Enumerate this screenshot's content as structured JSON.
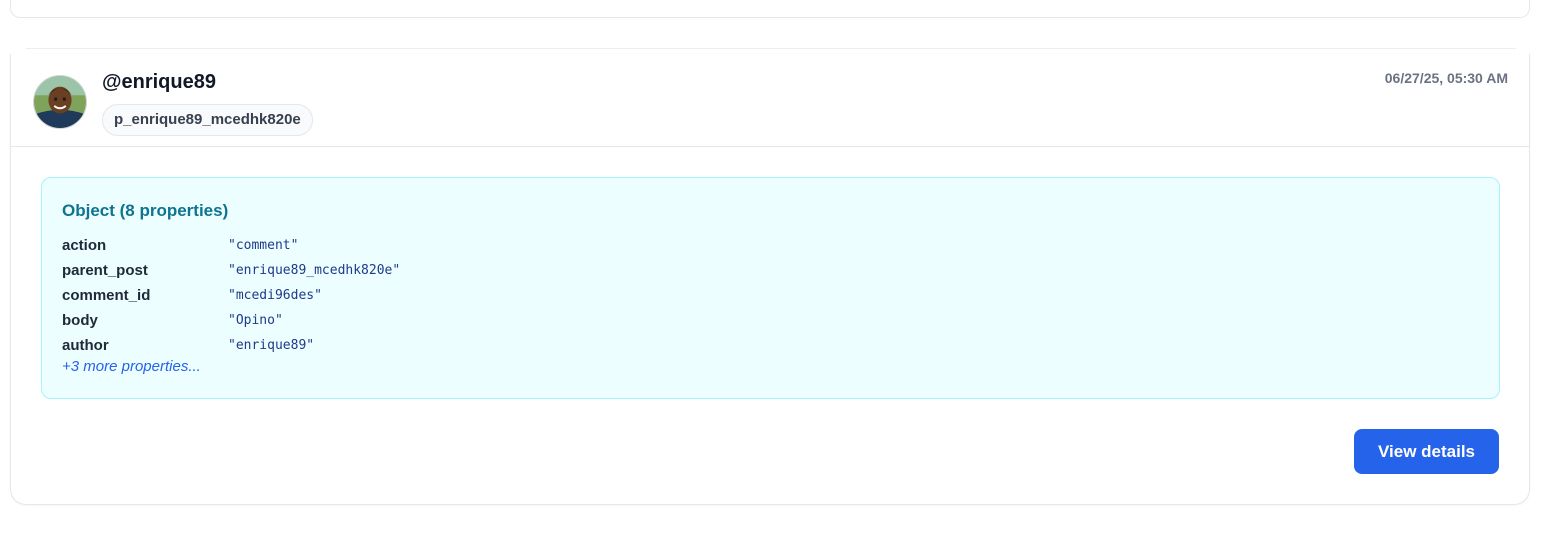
{
  "post": {
    "username": "@enrique89",
    "post_id": "p_enrique89_mcedhk820e",
    "timestamp": "06/27/25, 05:30 AM",
    "avatar_icon": "user-avatar-photo"
  },
  "object": {
    "title": "Object (8 properties)",
    "properties": [
      {
        "key": "action",
        "value": "\"comment\""
      },
      {
        "key": "parent_post",
        "value": "\"enrique89_mcedhk820e\""
      },
      {
        "key": "comment_id",
        "value": "\"mcedi96des\""
      },
      {
        "key": "body",
        "value": "\"Opino\""
      },
      {
        "key": "author",
        "value": "\"enrique89\""
      }
    ],
    "more_label": "+3 more properties..."
  },
  "actions": {
    "view_details_label": "View details"
  },
  "colors": {
    "accent": "#2563eb",
    "object_bg": "#ecfeff",
    "object_border": "#a5f3fc",
    "object_title": "#0e7490"
  }
}
